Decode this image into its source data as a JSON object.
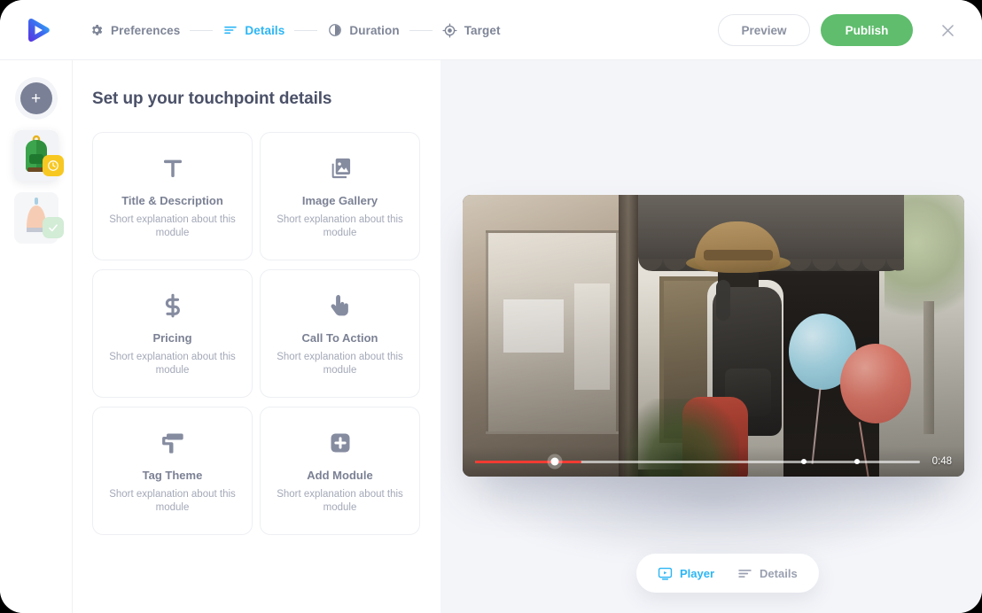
{
  "app": {
    "logo_icon": "play-logo-icon",
    "brand_gradient_from": "#2dc7f5",
    "brand_gradient_to": "#5b2fe0"
  },
  "stepper": {
    "steps": [
      {
        "label": "Preferences",
        "icon": "gear-icon",
        "active": false
      },
      {
        "label": "Details",
        "icon": "list-lines-icon",
        "active": true
      },
      {
        "label": "Duration",
        "icon": "half-circle-clock-icon",
        "active": false
      },
      {
        "label": "Target",
        "icon": "target-crosshair-icon",
        "active": false
      }
    ],
    "active_color": "#2cb6f5",
    "inactive_color": "#7e8597"
  },
  "top_actions": {
    "preview_label": "Preview",
    "publish_label": "Publish",
    "publish_color": "#5fbd6d",
    "close_icon": "close-icon"
  },
  "rail": {
    "add_button_icon": "plus-icon",
    "thumbnails": [
      {
        "name": "green-backpack-thumbnail",
        "badge": "clock-icon",
        "badge_color": "#f8c822",
        "selected": true
      },
      {
        "name": "pink-bell-thumbnail",
        "badge": "check-icon",
        "badge_color": "#d2ecd6",
        "selected": false
      }
    ]
  },
  "main": {
    "title": "Set up your touchpoint details",
    "modules": [
      {
        "title": "Title & Description",
        "desc": "Short explanation about this module",
        "icon": "text-t-icon"
      },
      {
        "title": "Image Gallery",
        "desc": "Short explanation about this module",
        "icon": "image-gallery-icon"
      },
      {
        "title": "Pricing",
        "desc": "Short explanation about this module",
        "icon": "dollar-sign-icon"
      },
      {
        "title": "Call To Action",
        "desc": "Short explanation about this module",
        "icon": "tap-hand-icon"
      },
      {
        "title": "Tag Theme",
        "desc": "Short explanation about this module",
        "icon": "paint-roller-icon"
      },
      {
        "title": "Add Module",
        "desc": "Short explanation about this module",
        "icon": "plus-square-icon"
      }
    ]
  },
  "preview": {
    "background_color": "#f4f5f9",
    "video": {
      "time_label": "0:48",
      "progress_percent": 24,
      "playhead_percent": 18,
      "markers_percent": [
        74,
        86
      ],
      "progress_color": "#f23b32",
      "scene_description": "Person with wide-brim hat and dark backpack walking down a street holding a light-blue and a red balloon"
    }
  },
  "bottom_tabs": [
    {
      "label": "Player",
      "icon": "monitor-play-icon",
      "active": true
    },
    {
      "label": "Details",
      "icon": "list-lines-icon",
      "active": false
    }
  ]
}
